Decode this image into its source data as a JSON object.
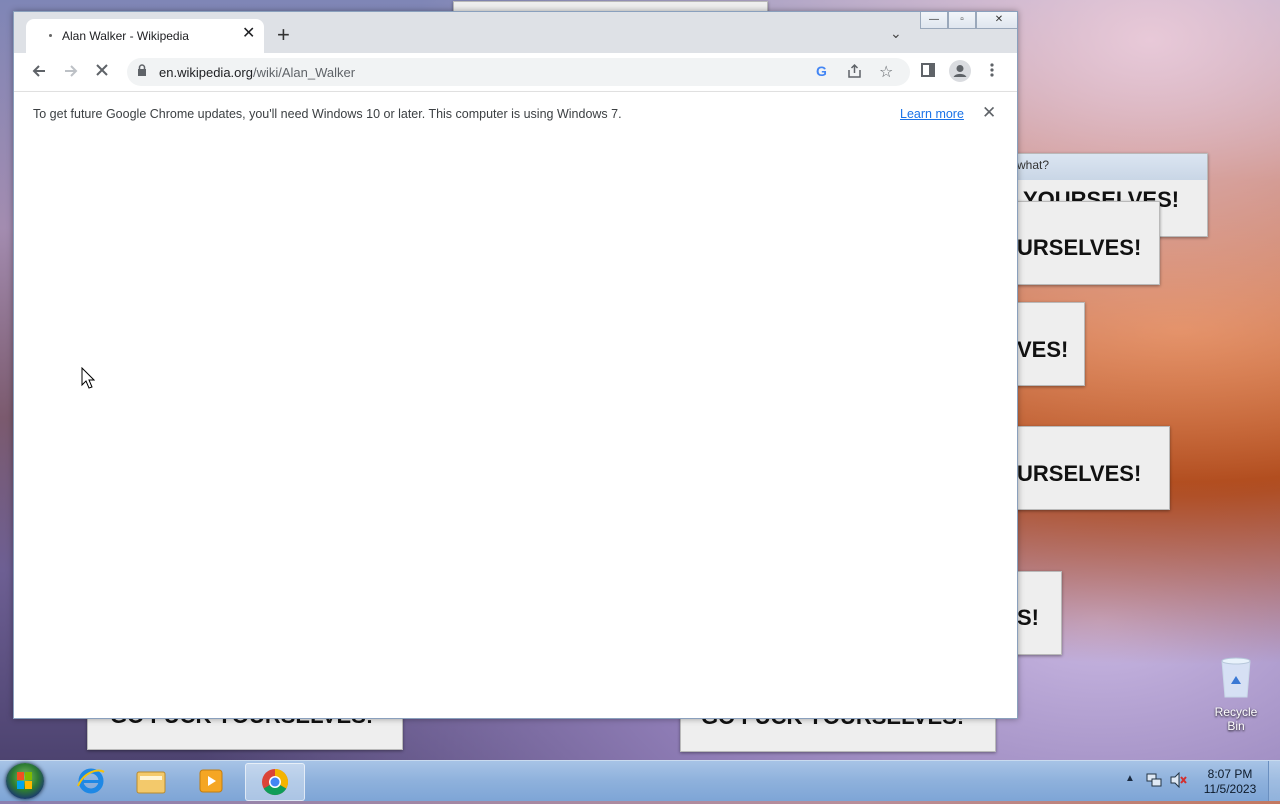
{
  "browser": {
    "tab_title": "Alan Walker - Wikipedia",
    "tab_close": "✕",
    "new_tab": "+",
    "tab_search": "⌄",
    "window_buttons": {
      "minimize": "—",
      "maximize": "▫",
      "close": "✕"
    },
    "url_domain": "en.wikipedia.org",
    "url_path": "/wiki/Alan_Walker",
    "infobar_message": "To get future Google Chrome updates, you'll need Windows 10 or later. This computer is using Windows 7.",
    "infobar_link": "Learn more",
    "infobar_close": "✕"
  },
  "background_popups": [
    {
      "title": "what?",
      "text": "YOURSELVES!"
    },
    {
      "text": "URSELVES!"
    },
    {
      "text": "VES!"
    },
    {
      "text": "URSELVES!"
    },
    {
      "text": "S!"
    },
    {
      "text": "GO FUCK YOURSELVES!"
    },
    {
      "text": "GO FUCK YOURSELVES!"
    }
  ],
  "desktop": {
    "recycle_bin_label": "Recycle Bin"
  },
  "taskbar": {
    "apps": [
      "internet-explorer",
      "windows-explorer",
      "media-player",
      "google-chrome"
    ],
    "active_app": "google-chrome",
    "time": "8:07 PM",
    "date": "11/5/2023"
  }
}
